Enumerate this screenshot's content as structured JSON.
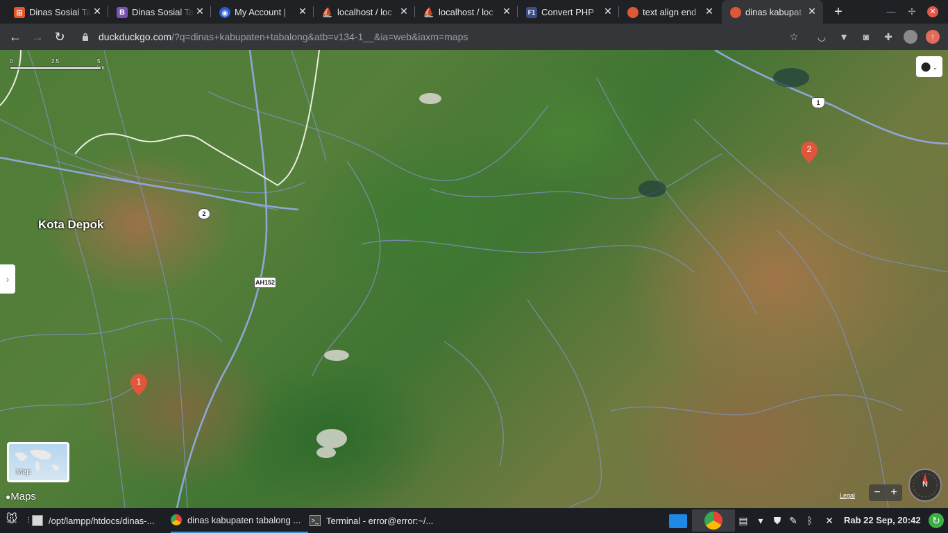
{
  "tabs": [
    {
      "title": "Dinas Sosial Ta",
      "favicon": "app-grid-icon",
      "color": "#e2572b",
      "glyph": "⊞"
    },
    {
      "title": "Dinas Sosial Ta",
      "favicon": "bootstrap-icon",
      "color": "#7952b3",
      "glyph": "B"
    },
    {
      "title": "My Account |",
      "favicon": "account-icon",
      "color": "#2b5bd6",
      "glyph": "◉"
    },
    {
      "title": "localhost / loc",
      "favicon": "phpmyadmin-icon",
      "color": "#e79b2e",
      "glyph": "⛵"
    },
    {
      "title": "localhost / loc",
      "favicon": "phpmyadmin-icon",
      "color": "#e79b2e",
      "glyph": "⛵"
    },
    {
      "title": "Convert PHP",
      "favicon": "f1-icon",
      "color": "#3a4a8a",
      "glyph": "F1"
    },
    {
      "title": "text align end",
      "favicon": "duckduckgo-icon",
      "color": "#de5833",
      "glyph": "●"
    },
    {
      "title": "dinas kabupat",
      "favicon": "duckduckgo-icon",
      "color": "#de5833",
      "glyph": "●"
    }
  ],
  "toolbar": {
    "host": "duckduckgo.com",
    "path": "/?q=dinas+kabupaten+tabalong&atb=v134-1__&ia=web&iaxm=maps"
  },
  "map": {
    "city_label": "Kota Depok",
    "shields": [
      "2",
      "AH152",
      "1"
    ],
    "markers": [
      "1",
      "2"
    ],
    "scale_ticks": [
      "0",
      "2.5",
      "5 km"
    ],
    "map_toggle_label": "Map",
    "brand": "Maps",
    "legal": "Legal",
    "compass_label": "N",
    "zoom_out": "−",
    "zoom_in": "+"
  },
  "taskbar": {
    "items": [
      {
        "label": "/opt/lampp/htdocs/dinas-...",
        "icon": "file-manager-icon"
      },
      {
        "label": "dinas kabupaten tabalong ...",
        "icon": "chrome-icon"
      },
      {
        "label": "Terminal - error@error:~/...",
        "icon": "terminal-icon"
      }
    ],
    "clock": "Rab 22 Sep, 20:42"
  },
  "colors": {
    "marker": "#e0563a",
    "active_tab": "#35363a",
    "taskbar_accent": "#3d8fd6"
  }
}
